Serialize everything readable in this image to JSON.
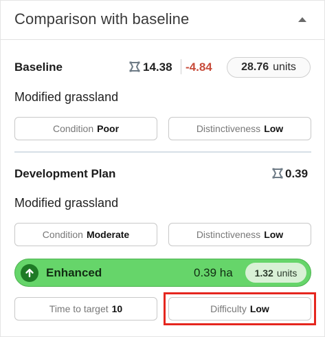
{
  "panel": {
    "title": "Comparison with baseline"
  },
  "baseline": {
    "title": "Baseline",
    "area_value": "14.38",
    "change_value": "-4.84",
    "units_value": "28.76",
    "units_label": "units",
    "habitat": "Modified grassland",
    "condition_label": "Condition",
    "condition_value": "Poor",
    "distinctiveness_label": "Distinctiveness",
    "distinctiveness_value": "Low"
  },
  "development": {
    "title": "Development Plan",
    "area_value": "0.39",
    "habitat": "Modified grassland",
    "condition_label": "Condition",
    "condition_value": "Moderate",
    "distinctiveness_label": "Distinctiveness",
    "distinctiveness_value": "Low",
    "enhanced": {
      "label": "Enhanced",
      "area": "0.39 ha",
      "units_value": "1.32",
      "units_label": "units",
      "color": "#66d56a"
    },
    "time_label": "Time to target",
    "time_value": "10",
    "difficulty_label": "Difficulty",
    "difficulty_value": "Low"
  },
  "colors": {
    "negative": "#c74b3a",
    "highlight": "#e5261e",
    "divider": "#d6dfe6"
  }
}
